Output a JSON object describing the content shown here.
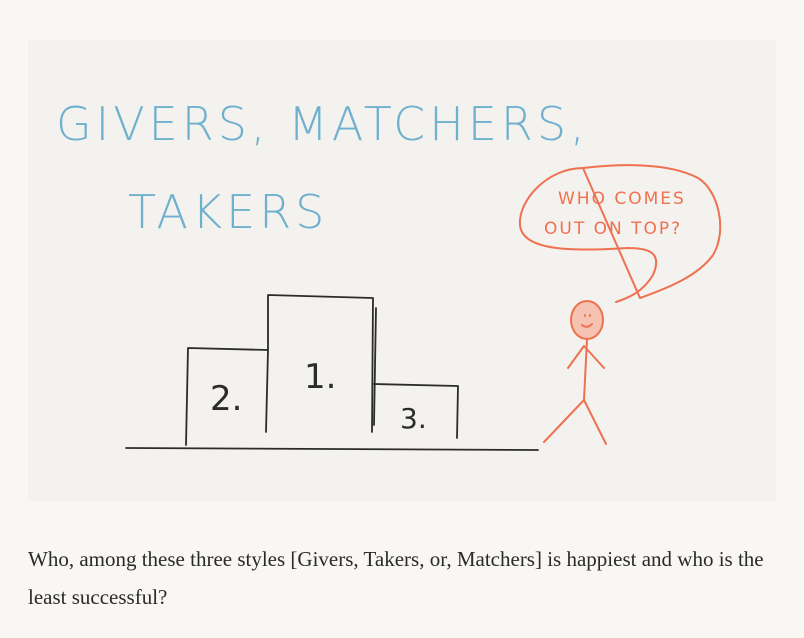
{
  "illustration": {
    "title_line1": "GIVERS, MATCHERS,",
    "title_line2": "TAKERS",
    "speech_line1": "WHO COMES",
    "speech_line2": "OUT ON TOP?",
    "podium_first": "1.",
    "podium_second": "2.",
    "podium_third": "3.",
    "colors": {
      "title": "#6fb0cf",
      "figure": "#ef7150",
      "face": "#f6c3b3",
      "podium": "#2b2b2b"
    }
  },
  "caption": {
    "text": "Who, among these three styles [Givers, Takers, or, Matchers] is happiest and who is the least successful?"
  }
}
